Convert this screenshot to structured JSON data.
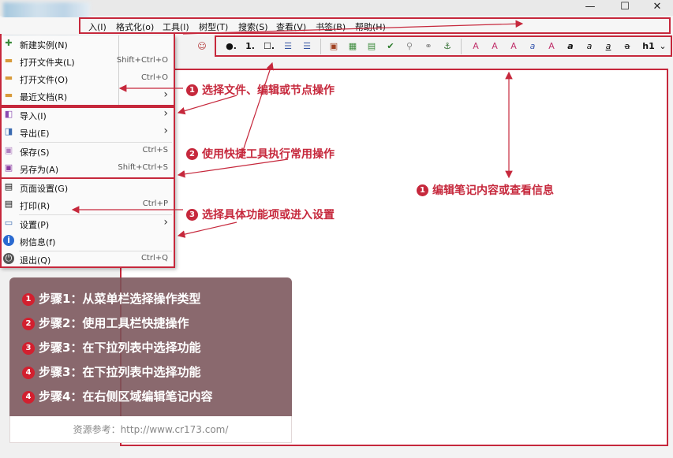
{
  "window": {
    "minimize": "—",
    "maximize": "☐",
    "close": "✕"
  },
  "menubar": {
    "items": [
      "入(I)",
      "格式化(o)",
      "工具(l)",
      "树型(T)",
      "搜索(S)",
      "查看(V)",
      "书签(B)",
      "帮助(H)"
    ]
  },
  "toolbar": {
    "list_bullet": "●.",
    "list_number": "1.",
    "list_todo": "☐.",
    "heading_select": "h1"
  },
  "dropdown": {
    "file_group": [
      {
        "label": "新建实例(N)",
        "shortcut": ""
      },
      {
        "label": "打开文件夹(L)",
        "shortcut": "Shift+Ctrl+O"
      },
      {
        "label": "打开文件(O)",
        "shortcut": "Ctrl+O"
      },
      {
        "label": "最近文档(R)",
        "shortcut": ""
      }
    ],
    "io_group": [
      {
        "label": "导入(I)",
        "shortcut": ""
      },
      {
        "label": "导出(E)",
        "shortcut": ""
      },
      {
        "label": "保存(S)",
        "shortcut": "Ctrl+S"
      },
      {
        "label": "另存为(A)",
        "shortcut": "Shift+Ctrl+S"
      }
    ],
    "settings_group": [
      {
        "label": "页面设置(G)",
        "shortcut": ""
      },
      {
        "label": "打印(R)",
        "shortcut": "Ctrl+P"
      },
      {
        "label": "设置(P)",
        "shortcut": ""
      },
      {
        "label": "树信息(f)",
        "shortcut": ""
      },
      {
        "label": "退出(Q)",
        "shortcut": "Ctrl+Q"
      }
    ],
    "submenu_arrow": "›"
  },
  "annotations": {
    "a1": {
      "num": "1",
      "text": "选择文件、编辑或节点操作"
    },
    "a2": {
      "num": "2",
      "text": "使用快捷工具执行常用操作"
    },
    "a3": {
      "num": "3",
      "text": "选择具体功能项或进入设置"
    },
    "a4": {
      "num": "1",
      "text": "编辑笔记内容或查看信息"
    }
  },
  "steps": [
    {
      "num": "1",
      "text": "步骤1：从菜单栏选择操作类型"
    },
    {
      "num": "2",
      "text": "步骤2：使用工具栏快捷操作"
    },
    {
      "num": "3",
      "text": "步骤3：在下拉列表中选择功能"
    },
    {
      "num": "4",
      "text": "步骤3：在下拉列表中选择功能"
    },
    {
      "num": "4",
      "text": "步骤4：在右侧区域编辑笔记内容"
    }
  ],
  "source": "资源参考：http://www.cr173.com/",
  "colors": {
    "accent": "#c6283c",
    "panel": "#7a545a"
  }
}
